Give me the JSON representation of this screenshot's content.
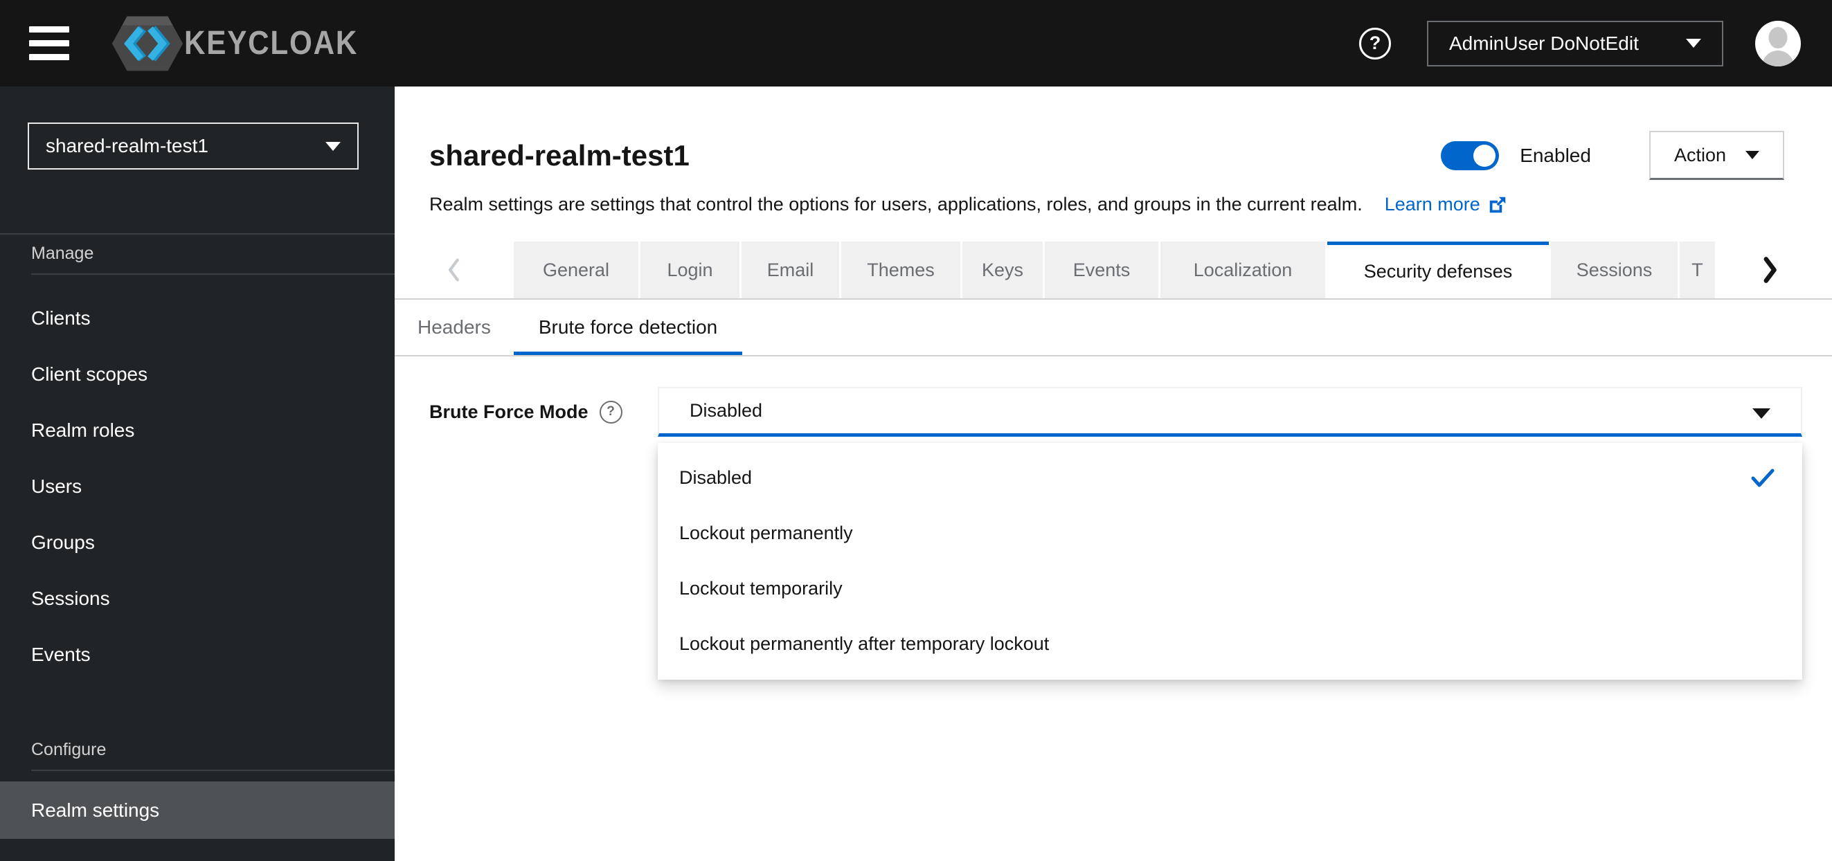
{
  "colors": {
    "accent": "#0066cc",
    "masthead_bg": "#151515",
    "sidebar_bg": "#212427",
    "sidebar_active_bg": "#4f5255",
    "tab_inactive_bg": "#f0f0f0",
    "muted_text": "#6a6e73",
    "border": "#d2d2d2",
    "logo_cyan": "#35b2e4"
  },
  "glyphs": {
    "question_mark": "?"
  },
  "header": {
    "brand": "KEYCLOAK",
    "user_menu": {
      "label": "AdminUser DoNotEdit"
    }
  },
  "sidebar": {
    "realm_selector": {
      "value": "shared-realm-test1"
    },
    "sections": [
      {
        "title": "Manage",
        "items": [
          {
            "label": "Clients"
          },
          {
            "label": "Client scopes"
          },
          {
            "label": "Realm roles"
          },
          {
            "label": "Users"
          },
          {
            "label": "Groups"
          },
          {
            "label": "Sessions"
          },
          {
            "label": "Events"
          }
        ]
      },
      {
        "title": "Configure",
        "items": [
          {
            "label": "Realm settings",
            "active": true
          }
        ]
      }
    ]
  },
  "page": {
    "title": "shared-realm-test1",
    "enabled_toggle": {
      "label": "Enabled",
      "state": "on"
    },
    "action_menu": {
      "label": "Action"
    },
    "description": "Realm settings are settings that control the options for users, applications, roles, and groups in the current realm.",
    "learn_more": {
      "label": "Learn more"
    }
  },
  "tabs": {
    "items": [
      {
        "label": "General"
      },
      {
        "label": "Login"
      },
      {
        "label": "Email"
      },
      {
        "label": "Themes"
      },
      {
        "label": "Keys"
      },
      {
        "label": "Events"
      },
      {
        "label": "Localization"
      },
      {
        "label": "Security defenses",
        "active": true
      },
      {
        "label": "Sessions"
      },
      {
        "label": "T"
      }
    ]
  },
  "subtabs": {
    "items": [
      {
        "label": "Headers"
      },
      {
        "label": "Brute force detection",
        "active": true
      }
    ]
  },
  "form": {
    "brute_force_mode": {
      "label": "Brute Force Mode",
      "value": "Disabled",
      "options": [
        {
          "label": "Disabled",
          "selected": true
        },
        {
          "label": "Lockout permanently"
        },
        {
          "label": "Lockout temporarily"
        },
        {
          "label": "Lockout permanently after temporary lockout"
        }
      ]
    }
  }
}
